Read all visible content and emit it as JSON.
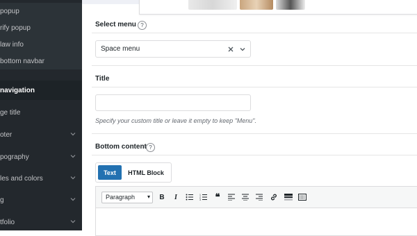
{
  "sidebar": {
    "items": [
      {
        "label": "popup",
        "has_chevron": false
      },
      {
        "label": "rify popup",
        "has_chevron": false
      },
      {
        "label": "law info",
        "has_chevron": false
      },
      {
        "label": "bottom navbar",
        "has_chevron": false
      },
      {
        "label": "navigation",
        "has_chevron": false
      },
      {
        "label": "ge title",
        "has_chevron": false
      },
      {
        "label": "oter",
        "has_chevron": true
      },
      {
        "label": "pography",
        "has_chevron": true
      },
      {
        "label": "les and colors",
        "has_chevron": true
      },
      {
        "label": "g",
        "has_chevron": true
      },
      {
        "label": "tfolio",
        "has_chevron": true
      }
    ]
  },
  "form": {
    "select_menu": {
      "label": "Select menu",
      "value": "Space menu"
    },
    "title": {
      "label": "Title",
      "value": "",
      "hint": "Specify your custom title or leave it empty to keep \"Menu\"."
    },
    "bottom_content": {
      "label": "Bottom content",
      "tabs": [
        {
          "label": "Text",
          "active": true
        },
        {
          "label": "HTML Block",
          "active": false
        }
      ],
      "editor": {
        "format_value": "Paragraph"
      }
    }
  },
  "colors": {
    "sidebar_bg": "#23282d",
    "accent": "#2271b1"
  },
  "icons": [
    "help-icon",
    "clear-icon",
    "chevron-down-icon",
    "bold-icon",
    "italic-icon",
    "bullet-list-icon",
    "numbered-list-icon",
    "blockquote-icon",
    "align-left-icon",
    "align-center-icon",
    "align-right-icon",
    "link-icon",
    "horizontal-rule-icon",
    "toolbar-toggle-icon"
  ]
}
